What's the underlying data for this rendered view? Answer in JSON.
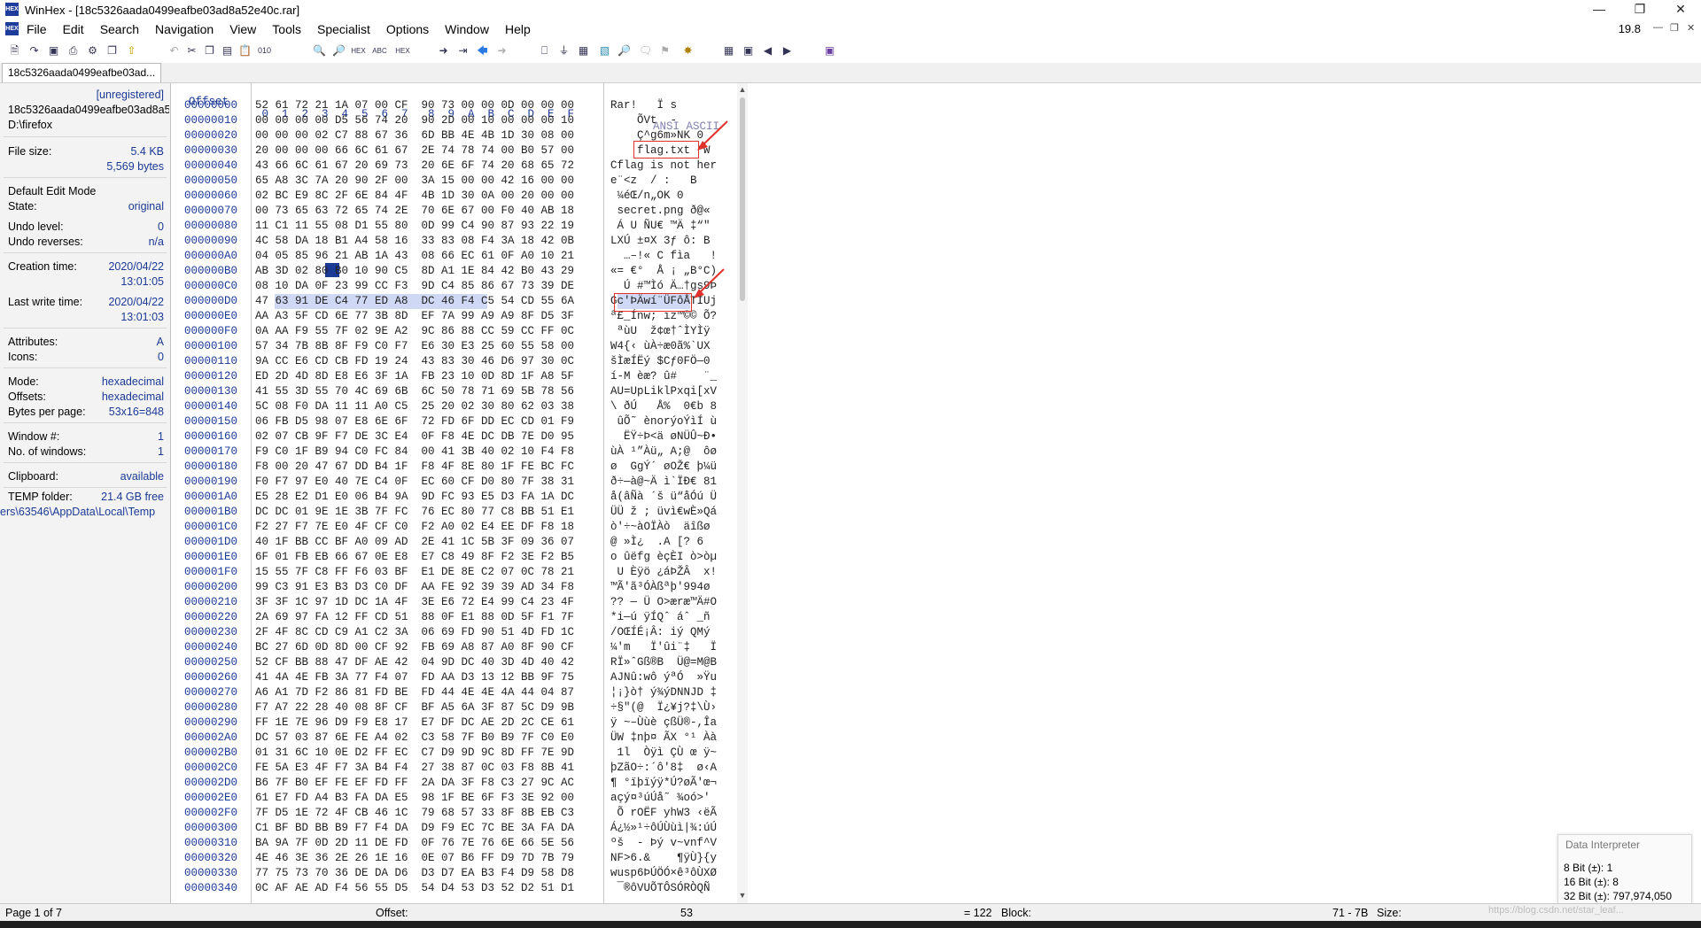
{
  "window": {
    "title": "WinHex - [18c5326aada0499eafbe03ad8a52e40c.rar]",
    "app_icon": "HEX",
    "zoom": "19.8"
  },
  "menu": [
    "File",
    "Edit",
    "Search",
    "Navigation",
    "View",
    "Tools",
    "Specialist",
    "Options",
    "Window",
    "Help"
  ],
  "tab": {
    "label": "18c5326aada0499eafbe03ad..."
  },
  "sidebar": {
    "unregistered": "[unregistered]",
    "filename": "18c5326aada0499eafbe03ad8a52e40c.rar",
    "folder": "D:\\firefox",
    "file_size_label": "File size:",
    "file_size_kb": "5.4 KB",
    "file_size_bytes": "5,569 bytes",
    "edit_mode_label": "Default Edit Mode",
    "state_label": "State:",
    "state_value": "original",
    "undo_level_label": "Undo level:",
    "undo_level_value": "0",
    "undo_rev_label": "Undo reverses:",
    "undo_rev_value": "n/a",
    "creation_label": "Creation time:",
    "creation_date": "2020/04/22",
    "creation_time": "13:01:05",
    "lastwrite_label": "Last write time:",
    "lastwrite_date": "2020/04/22",
    "lastwrite_time": "13:01:03",
    "attributes_label": "Attributes:",
    "attributes_value": "A",
    "icons_label": "Icons:",
    "icons_value": "0",
    "mode_label": "Mode:",
    "mode_value": "hexadecimal",
    "offsets_label": "Offsets:",
    "offsets_value": "hexadecimal",
    "bpp_label": "Bytes per page:",
    "bpp_value": "53x16=848",
    "window_no_label": "Window #:",
    "window_no_value": "1",
    "windows_count_label": "No. of windows:",
    "windows_count_value": "1",
    "clipboard_label": "Clipboard:",
    "clipboard_value": "available",
    "temp_label": "TEMP folder:",
    "temp_free": "21.4 GB free",
    "temp_path": "ers\\63546\\AppData\\Local\\Temp"
  },
  "hex": {
    "offset_header": "Offset",
    "columns_header": " 0  1  2  3  4  5  6  7   8  9  A  B  C  D  E  F",
    "ansi_header": "ANSI ASCII",
    "rows": [
      {
        "o": "00000000",
        "h": "52 61 72 21 1A 07 00 CF  90 73 00 00 0D 00 00 00",
        "a": "Rar!   Ï s     "
      },
      {
        "o": "00000010",
        "h": "00 00 00 00 D5 56 74 20  90 2D 00 10 00 00 00 10",
        "a": "    ÕVt  -      "
      },
      {
        "o": "00000020",
        "h": "00 00 00 02 C7 88 67 36  6D BB 4E 4B 1D 30 08 00",
        "a": "    Ç^g6m»NK 0  "
      },
      {
        "o": "00000030",
        "h": "20 00 00 00 66 6C 61 67  2E 74 78 74 00 B0 57 00",
        "a": "    flag.txt °W "
      },
      {
        "o": "00000040",
        "h": "43 66 6C 61 67 20 69 73  20 6E 6F 74 20 68 65 72",
        "a": "Cflag is not her"
      },
      {
        "o": "00000050",
        "h": "65 A8 3C 7A 20 90 2F 00  3A 15 00 00 42 16 00 00",
        "a": "e¨<z  / :   B   "
      },
      {
        "o": "00000060",
        "h": "02 BC E9 8C 2F 6E 84 4F  4B 1D 30 0A 00 20 00 00",
        "a": " ¼éŒ/n„OK 0    "
      },
      {
        "o": "00000070",
        "h": "00 73 65 63 72 65 74 2E  70 6E 67 00 F0 40 AB 18",
        "a": " secret.png ð@« "
      },
      {
        "o": "00000080",
        "h": "11 C1 11 55 08 D1 55 80  0D 99 C4 90 87 93 22 19",
        "a": " Á U ÑU€ ™Ä ‡“\" "
      },
      {
        "o": "00000090",
        "h": "4C 58 DA 18 B1 A4 58 16  33 83 08 F4 3A 18 42 0B",
        "a": "LXÚ ±¤X 3ƒ ô: B "
      },
      {
        "o": "000000A0",
        "h": "04 05 85 96 21 AB 1A 43  08 66 EC 61 0F A0 10 21",
        "a": "  …–!« C fìa   !"
      },
      {
        "o": "000000B0",
        "h": "AB 3D 02 80 B0 10 90 C5  8D A1 1E 84 42 B0 43 29",
        "a": "«= €°  Å ¡ „B°C)"
      },
      {
        "o": "000000C0",
        "h": "08 10 DA 0F 23 99 CC F3  9D C4 85 86 67 73 39 DE",
        "a": "  Ú #™Ìó Ä…†gs9Þ"
      },
      {
        "o": "000000D0",
        "h": "47 63 91 DE C4 77 ED A8  DC 46 F4 C5 54 CD 55 6A",
        "a": "Gc'ÞÄwí¨ÜFôÅTÍUj"
      },
      {
        "o": "000000E0",
        "h": "AA A3 5F CD 6E 77 3B 8D  EF 7A 99 A9 A9 8F D5 3F",
        "a": "ª£_Ínw; ïz™©© Õ?"
      },
      {
        "o": "000000F0",
        "h": "0A AA F9 55 7F 02 9E A2  9C 86 88 CC 59 CC FF 0C",
        "a": " ªùU  ž¢œ†ˆÌYÌÿ "
      },
      {
        "o": "00000100",
        "h": "57 34 7B 8B 8F F9 C0 F7  E6 30 E3 25 60 55 58 00",
        "a": "W4{‹ ùÀ÷æ0ã%`UX "
      },
      {
        "o": "00000110",
        "h": "9A CC E6 CD CB FD 19 24  43 83 30 46 D6 97 30 0C",
        "a": "šÌæÍËý $Cƒ0FÖ—0 "
      },
      {
        "o": "00000120",
        "h": "ED 2D 4D 8D E8 E6 3F 1A  FB 23 10 0D 8D 1F A8 5F",
        "a": "í-M èæ? û#    ¨_"
      },
      {
        "o": "00000130",
        "h": "41 55 3D 55 70 4C 69 6B  6C 50 78 71 69 5B 78 56",
        "a": "AU=UpLiklPxqi[xV"
      },
      {
        "o": "00000140",
        "h": "5C 08 F0 DA 11 11 A0 C5  25 20 02 30 80 62 03 38",
        "a": "\\ ðÚ   Å%  0€b 8"
      },
      {
        "o": "00000150",
        "h": "06 FB D5 98 07 E8 6E 6F  72 FD 6F DD EC CD 01 F9",
        "a": " ûÕ˜ ènorýoÝìÍ ù"
      },
      {
        "o": "00000160",
        "h": "02 07 CB 9F F7 DE 3C E4  0F F8 4E DC DB 7E D0 95",
        "a": "  ËŸ÷Þ<ä øNÜÛ~Ð•"
      },
      {
        "o": "00000170",
        "h": "F9 C0 1F B9 94 C0 FC 84  00 41 3B 40 02 10 F4 F8",
        "a": "ùÀ ¹”Àü„ A;@  ôø"
      },
      {
        "o": "00000180",
        "h": "F8 00 20 47 67 DD B4 1F  F8 4F 8E 80 1F FE BC FC",
        "a": "ø  GgÝ´ øOŽ€ þ¼ü"
      },
      {
        "o": "00000190",
        "h": "F0 F7 97 E0 40 7E C4 0F  EC 60 CF D0 80 7F 38 31",
        "a": "ð÷—à@~Ä ì`ÏÐ€ 81"
      },
      {
        "o": "000001A0",
        "h": "E5 28 E2 D1 E0 06 B4 9A  9D FC 93 E5 D3 FA 1A DC",
        "a": "å(âÑà ´š ü“åÓú Ü"
      },
      {
        "o": "000001B0",
        "h": "DC DC 01 9E 1E 3B 7F FC  76 EC 80 77 C8 BB 51 E1",
        "a": "ÜÜ ž ; üvì€wÈ»Qá"
      },
      {
        "o": "000001C0",
        "h": "F2 27 F7 7E E0 4F CF C0  F2 A0 02 E4 EE DF F8 18",
        "a": "ò'÷~àOÏÀò  äîßø "
      },
      {
        "o": "000001D0",
        "h": "40 1F BB CC BF A0 09 AD  2E 41 1C 5B 3F 09 36 07",
        "a": "@ »Ì¿  ­.A [? 6 "
      },
      {
        "o": "000001E0",
        "h": "6F 01 FB EB 66 67 0E E8  E7 C8 49 8F F2 3E F2 B5",
        "a": "o ûëfg èçÈI ò>òµ"
      },
      {
        "o": "000001F0",
        "h": "15 55 7F C8 FF F6 03 BF  E1 DE 8E C2 07 0C 78 21",
        "a": " U Èÿö ¿áÞŽÂ  x!"
      },
      {
        "o": "00000200",
        "h": "99 C3 91 E3 B3 D3 C0 DF  AA FE 92 39 39 AD 34 F8",
        "a": "™Ã'ã³ÓÀßªþ'99­4ø"
      },
      {
        "o": "00000210",
        "h": "3F 3F 1C 97 1D DC 1A 4F  3E E6 72 E4 99 C4 23 4F",
        "a": "?? — Ü O>æræ™Ä#O"
      },
      {
        "o": "00000220",
        "h": "2A 69 97 FA 12 FF CD 51  88 0F E1 88 0D 5F F1 7F",
        "a": "*i—ú ÿÍQˆ áˆ _ñ "
      },
      {
        "o": "00000230",
        "h": "2F 4F 8C CD C9 A1 C2 3A  06 69 FD 90 51 4D FD 1C",
        "a": "/OŒÍÉ¡Â: iý QMý "
      },
      {
        "o": "00000240",
        "h": "BC 27 6D 0D 8D 00 CF 92  FB 69 A8 87 A0 8F 90 CF",
        "a": "¼'m   Ï'ûi¨‡   Ï"
      },
      {
        "o": "00000250",
        "h": "52 CF BB 88 47 DF AE 42  04 9D DC 40 3D 4D 40 42",
        "a": "RÏ»ˆGß®B  Ü@=M@B"
      },
      {
        "o": "00000260",
        "h": "41 4A 4E FB 3A 77 F4 07  FD AA D3 13 12 BB 9F 75",
        "a": "AJNû:wô ýªÓ  »Ÿu"
      },
      {
        "o": "00000270",
        "h": "A6 A1 7D F2 86 81 FD BE  FD 44 4E 4E 4A 44 04 87",
        "a": "¦¡}ò† ý¾ýDNNJD ‡"
      },
      {
        "o": "00000280",
        "h": "F7 A7 22 28 40 08 8F CF  BF A5 6A 3F 87 5C D9 9B",
        "a": "÷§\"(@  Ï¿¥j?‡\\Ù›"
      },
      {
        "o": "00000290",
        "h": "FF 1E 7E 96 D9 F9 E8 17  E7 DF DC AE 2D 2C CE 61",
        "a": "ÿ ~–Ùùè çßÜ®-,Îa"
      },
      {
        "o": "000002A0",
        "h": "DC 57 03 87 6E FE A4 02  C3 58 7F B0 B9 7F C0 E0",
        "a": "ÜW ‡nþ¤ ÃX °¹ Àà"
      },
      {
        "o": "000002B0",
        "h": "01 31 6C 10 0E D2 FF EC  C7 D9 9D 9C 8D FF 7E 9D",
        "a": " 1l  Òÿì ÇÙ œ ÿ~ "
      },
      {
        "o": "000002C0",
        "h": "FE 5A E3 4F F7 3A B4 F4  27 38 87 0C 03 F8 8B 41",
        "a": "þZãO÷:´ô'8‡  ø‹A"
      },
      {
        "o": "000002D0",
        "h": "B6 7F B0 EF FE EF FD FF  2A DA 3F F8 C3 27 9C AC",
        "a": "¶ °ïþïýÿ*Ú?øÃ'œ¬"
      },
      {
        "o": "000002E0",
        "h": "61 E7 FD A4 B3 FA DA E5  98 1F BE 6F F3 3E 92 00",
        "a": "açý¤³úÚå˜ ¾oó>' "
      },
      {
        "o": "000002F0",
        "h": "7F D5 1E 72 4F CB 46 1C  79 68 57 33 8F 8B EB C3",
        "a": " Õ rOËF yhW3 ‹ëÃ"
      },
      {
        "o": "00000300",
        "h": "C1 BF BD BB B9 F7 F4 DA  D9 F9 EC 7C BE 3A FA DA",
        "a": "Á¿½»¹÷ôÚÙùì|¾:úÚ"
      },
      {
        "o": "00000310",
        "h": "BA 9A 7F 0D 2D 11 DE FD  0F 76 7E 76 6E 66 5E 56",
        "a": "ºš  - Þý v~vnf^V"
      },
      {
        "o": "00000320",
        "h": "4E 46 3E 36 2E 26 1E 16  0E 07 B6 FF D9 7D 7B 79",
        "a": "NF>6.&    ¶ÿÙ}{y"
      },
      {
        "o": "00000330",
        "h": "77 75 73 70 36 DE DA D6  D3 D7 EA B3 F4 D9 58 D8",
        "a": "wusp6ÞÚÖÓ×ê³ôÙXØ"
      },
      {
        "o": "00000340",
        "h": "0C AF AE AD F4 56 55 D5  54 D4 53 D3 52 D2 51 D1",
        "a": " ¯®­ôVUÕTÔSÓRÒQÑ"
      }
    ]
  },
  "status": {
    "page": "Page 1 of 7",
    "offset_label": "Offset:",
    "offset_value": "53",
    "eq_value": "= 122",
    "block_label": "Block:",
    "block_value": "71 - 7B",
    "size_label": "Size:"
  },
  "data_interpreter": {
    "title": "Data Interpreter",
    "bit8": "8 Bit (±): 1",
    "bit16": "16 Bit (±): 8",
    "bit32": "32 Bit (±): 797,974,050"
  },
  "watermark": "https://blog.csdn.net/star_leaf..."
}
